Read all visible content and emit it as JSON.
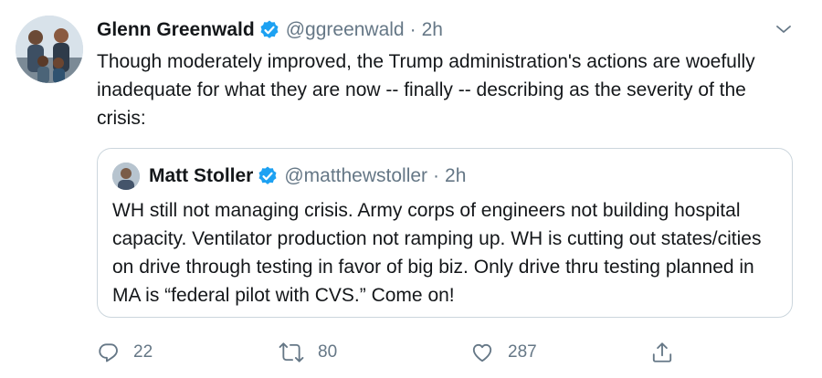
{
  "tweet": {
    "author_name": "Glenn Greenwald",
    "handle": "@ggreenwald",
    "separator": "·",
    "time": "2h",
    "text": "Though moderately improved, the Trump administration's actions are woefully inadequate for what they are now -- finally -- describing as the severity of the crisis:"
  },
  "quoted_tweet": {
    "author_name": "Matt Stoller",
    "handle": "@matthewstoller",
    "separator": "·",
    "time": "2h",
    "text": "WH still not managing crisis. Army corps of engineers not building hospital capacity. Ventilator production not ramping up. WH is cutting out states/cities on drive through testing in favor of big biz. Only drive thru testing planned in MA is “federal pilot with CVS.” Come on!"
  },
  "actions": {
    "reply_count": "22",
    "retweet_count": "80",
    "like_count": "287"
  },
  "icons": {
    "verified": "verified-badge-icon",
    "caret": "chevron-down-icon",
    "reply": "reply-icon",
    "retweet": "retweet-icon",
    "like": "heart-icon",
    "share": "share-icon"
  },
  "colors": {
    "verified_blue": "#1da1f2",
    "secondary_text": "#657786",
    "primary_text": "#14171a",
    "border": "#ccd6dd"
  }
}
